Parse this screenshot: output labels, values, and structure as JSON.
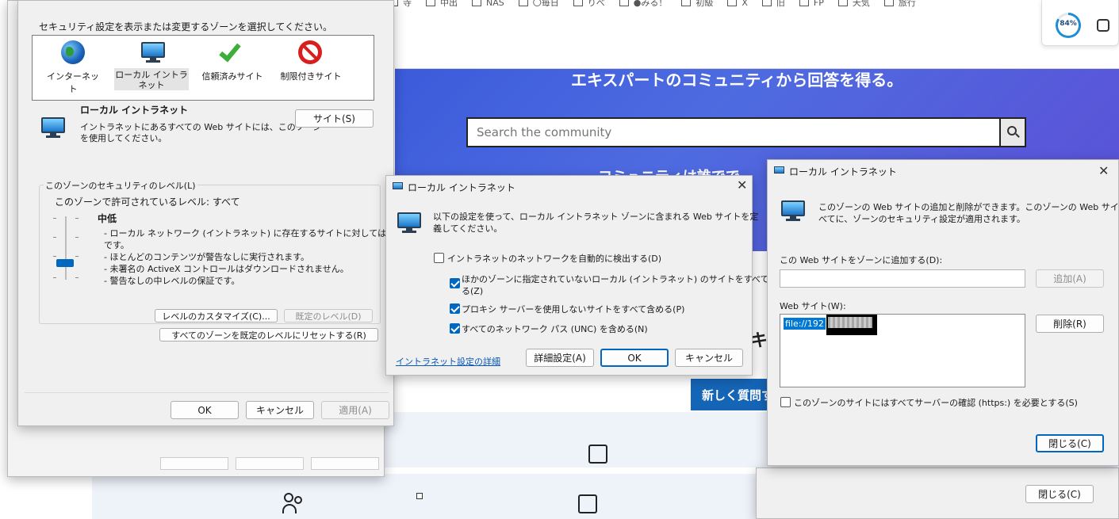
{
  "browser": {
    "bookmarks": [
      "寺",
      "中出",
      "NAS",
      "〇毎日",
      "りべ",
      "●みる！",
      "初級",
      "X",
      "旧",
      "FP",
      "天気",
      "旅行"
    ],
    "progress_text": "84%",
    "progress_value": 0.84,
    "hero_text": "エキスパートのコミュニティから回答を得る。",
    "search_placeholder": "Search the community",
    "hero_partial_text": "コミュニティは誰でで",
    "partial_char": "キ",
    "ask_button_label": "新しく質問す"
  },
  "security_dialog": {
    "instruction": "セキュリティ設定を表示または変更するゾーンを選択してください。",
    "zones": [
      {
        "label": "インターネット",
        "icon": "globe-icon"
      },
      {
        "label": "ローカル イントラネット",
        "icon": "intranet-monitor-icon"
      },
      {
        "label": "信頼済みサイト",
        "icon": "checkmark-icon"
      },
      {
        "label": "制限付きサイト",
        "icon": "restricted-icon"
      }
    ],
    "selected_zone_title": "ローカル イントラネット",
    "selected_zone_desc_1": "イントラネットにあるすべての Web サイトには、このゾーン",
    "selected_zone_desc_2": "を使用してください。",
    "sites_button": "サイト(S)",
    "level_group_label": "このゾーンのセキュリティのレベル(L)",
    "allowed_level": "このゾーンで許可されているレベル: すべて",
    "level_name": "中低",
    "level_value": 0.33,
    "level_desc": [
      "- ローカル ネットワーク (イントラネット) に存在するサイトに対しては、適切",
      "です。",
      "- ほとんどのコンテンツが警告なしに実行されます。",
      "- 未署名の ActiveX コントロールはダウンロードされません。",
      "- 警告なしの中レベルの保証です。"
    ],
    "customize_button": "レベルのカスタマイズ(C)...",
    "default_level_button": "既定のレベル(D)",
    "reset_all_button": "すべてのゾーンを既定のレベルにリセットする(R)",
    "ok": "OK",
    "cancel": "キャンセル",
    "apply": "適用(A)"
  },
  "intranet_dialog": {
    "title": "ローカル イントラネット",
    "desc_1": "以下の設定を使って、ローカル イントラネット ゾーンに含まれる Web サイトを定",
    "desc_2": "義してください。",
    "options": [
      {
        "label": "イントラネットのネットワークを自動的に検出する(D)",
        "checked": false
      },
      {
        "label": "ほかのゾーンに指定されていないローカル (イントラネット) のサイトをすべて含め",
        "label2": "る(Z)",
        "checked": true
      },
      {
        "label": "プロキシ サーバーを使用しないサイトをすべて含める(P)",
        "checked": true
      },
      {
        "label": "すべてのネットワーク パス (UNC) を含める(N)",
        "checked": true
      }
    ],
    "link": "イントラネット設定の詳細",
    "advanced_button": "詳細設定(A)",
    "ok": "OK",
    "cancel": "キャンセル"
  },
  "sites_dialog": {
    "title": "ローカル イントラネット",
    "desc_1": "このゾーンの Web サイトの追加と削除ができます。このゾーンの Web サイトす",
    "desc_2": "べてに、ゾーンのセキュリティ設定が適用されます。",
    "add_label": "この Web サイトをゾーンに追加する(D):",
    "add_value": "",
    "add_button": "追加(A)",
    "websites_label": "Web サイト(W):",
    "websites": [
      "file://192"
    ],
    "remove_button": "削除(R)",
    "https_label": "このゾーンのサイトにはすべてサーバーの確認 (https:) を必要とする(S)",
    "https_checked": false,
    "close_button": "閉じる(C)"
  },
  "back_dialog": {
    "close_button": "閉じる(C)"
  }
}
